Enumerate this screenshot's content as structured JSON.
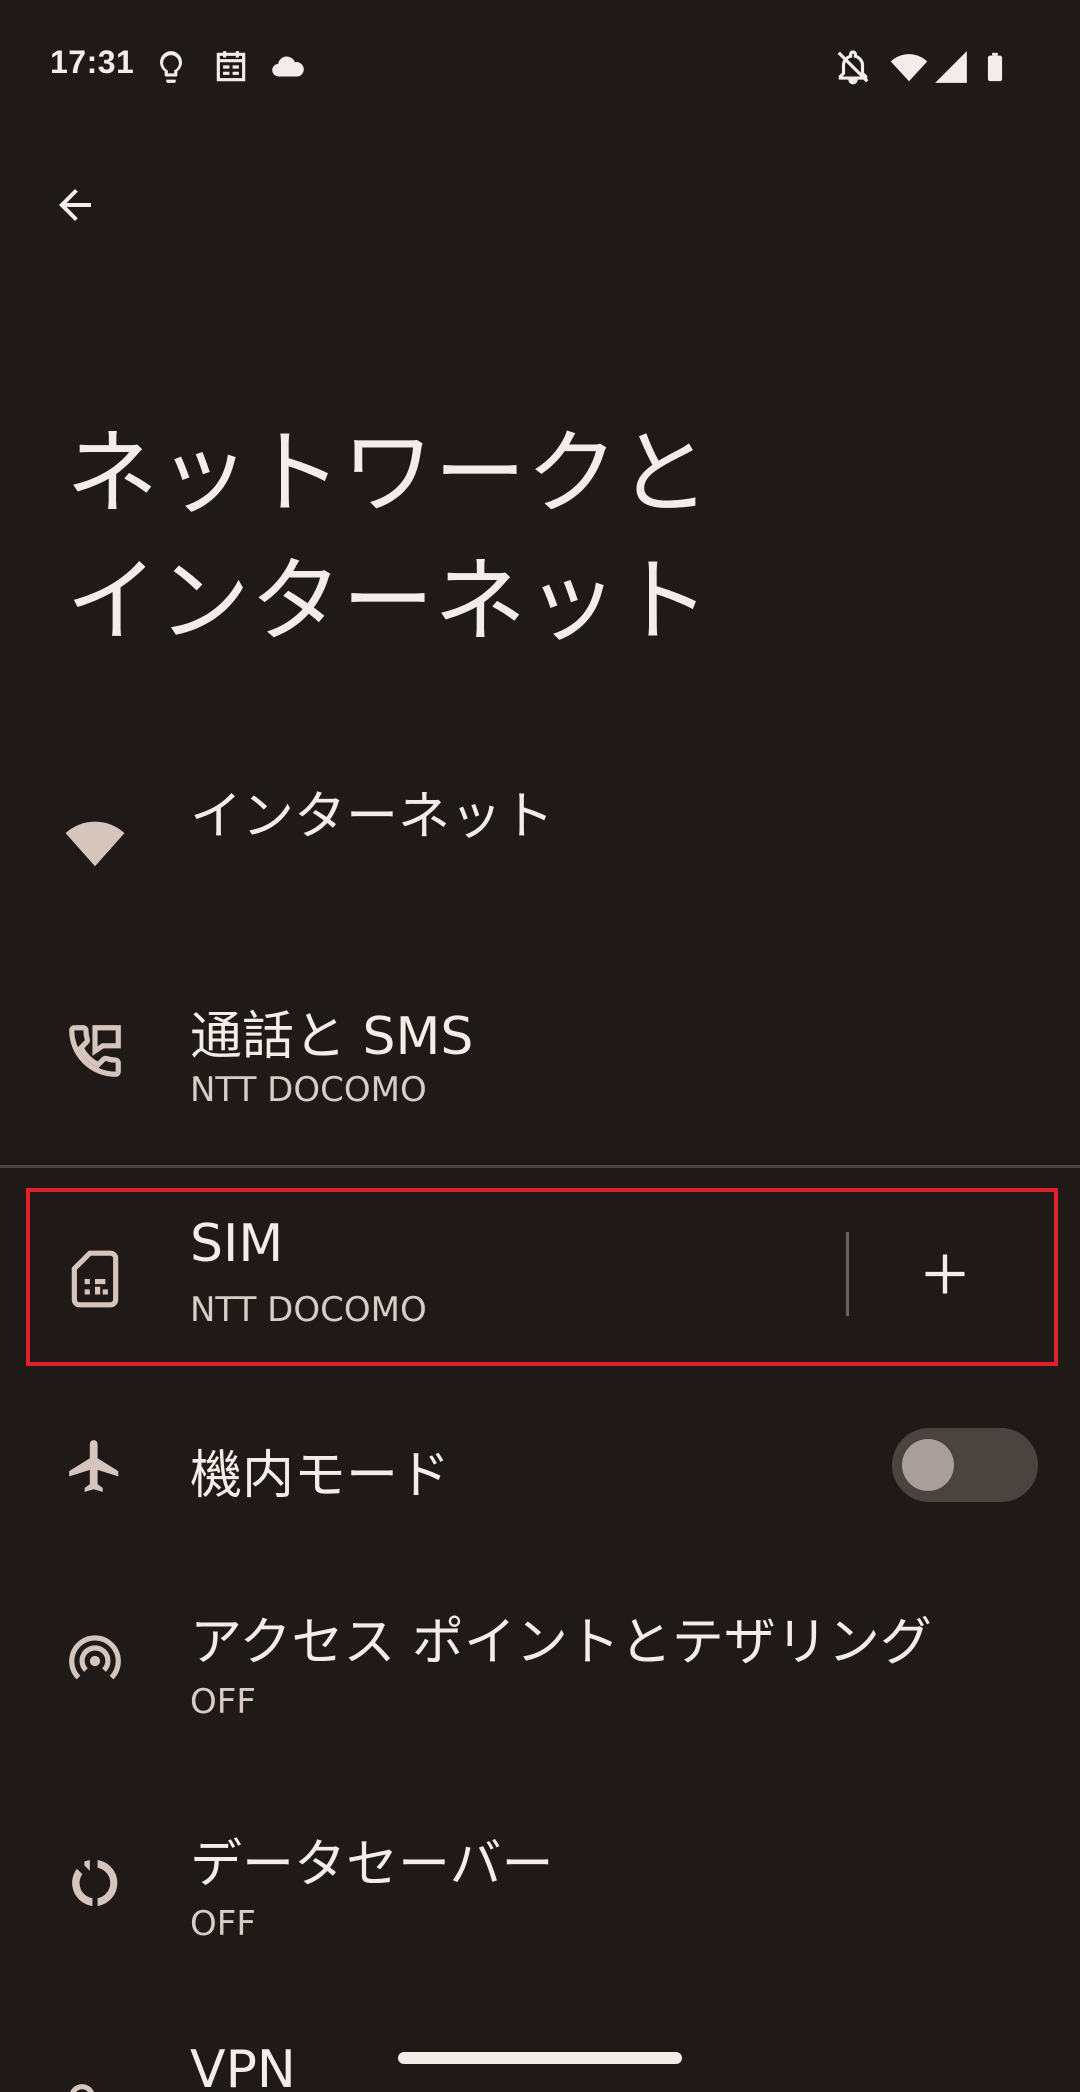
{
  "status_bar": {
    "time": "17:31",
    "left_icons": [
      "lightbulb-icon",
      "calendar-icon",
      "cloud-icon"
    ],
    "right_icons": [
      "bell-off-icon",
      "wifi-icon",
      "cellular-signal-icon",
      "battery-icon"
    ]
  },
  "header": {
    "back_icon": "arrow-left-icon",
    "title": "ネットワークと\nインターネット"
  },
  "items": [
    {
      "key": "internet",
      "icon": "wifi-icon",
      "title": "インターネット",
      "subtitle": ""
    },
    {
      "key": "calls_sms",
      "icon": "phone-message-icon",
      "title": "通話と SMS",
      "subtitle": "NTT DOCOMO"
    },
    {
      "key": "sim",
      "icon": "sim-card-icon",
      "title": "SIM",
      "subtitle": "NTT DOCOMO",
      "action_icon": "plus-icon"
    },
    {
      "key": "airplane",
      "icon": "airplane-icon",
      "title": "機内モード",
      "subtitle": "",
      "toggle_on": false
    },
    {
      "key": "hotspot",
      "icon": "hotspot-icon",
      "title": "アクセス ポイントとテザリング",
      "subtitle": "OFF"
    },
    {
      "key": "data_saver",
      "icon": "data-saver-icon",
      "title": "データセーバー",
      "subtitle": "OFF"
    },
    {
      "key": "vpn",
      "icon": "vpn-key-icon",
      "title": "VPN",
      "subtitle": ""
    }
  ],
  "colors": {
    "background": "#1f1a18",
    "text_primary": "#f4ece8",
    "text_secondary": "#d9ccc6",
    "icon": "#d6c5bd",
    "highlight": "#e0202b"
  }
}
